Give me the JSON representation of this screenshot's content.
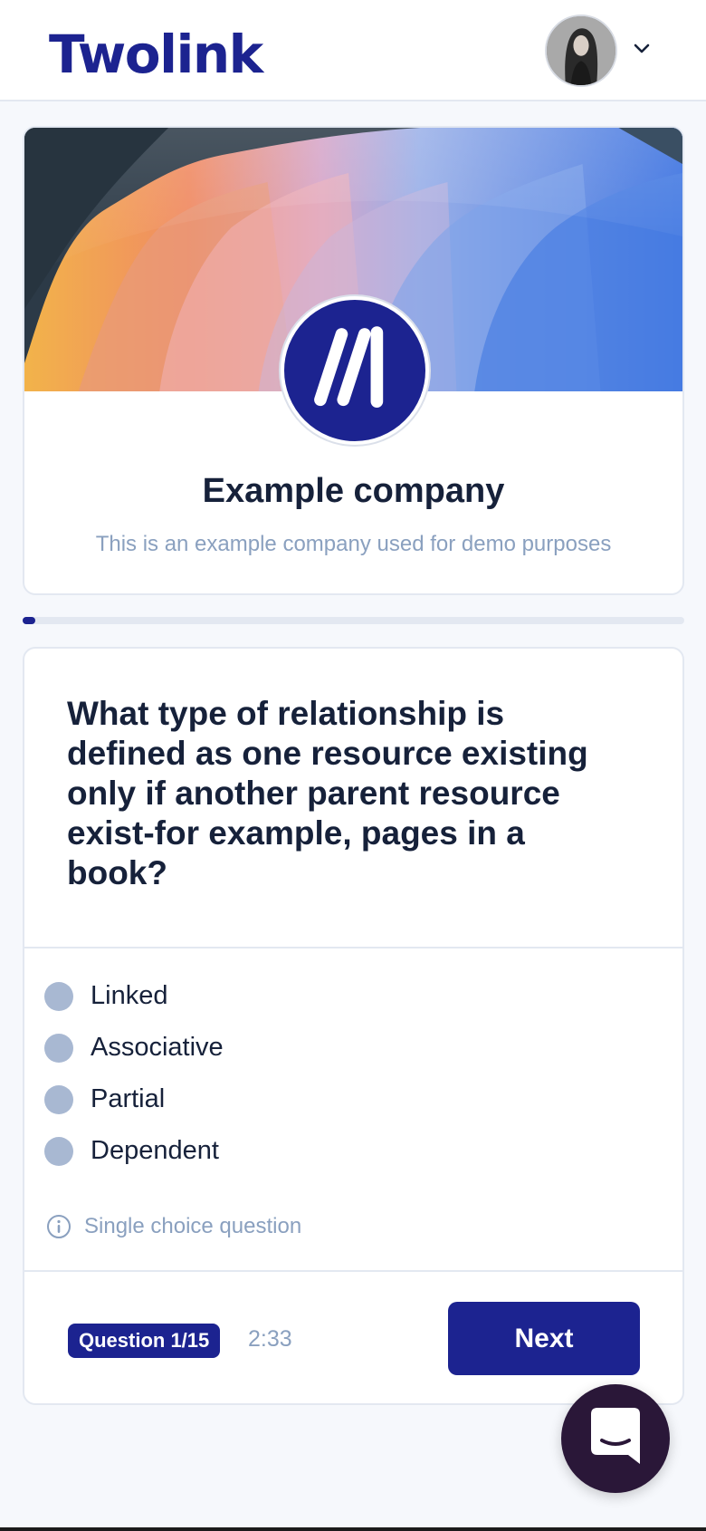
{
  "header": {
    "logo_text": "Twolink",
    "avatar_icon": "user-avatar",
    "menu_icon": "chevron-down-icon"
  },
  "company": {
    "name": "Example company",
    "description": "This is an example company used for demo purposes",
    "logo_icon": "company-logo-slashes"
  },
  "progress": {
    "fraction": 0.0667
  },
  "question": {
    "text": "What type of relationship is defined as one resource existing only if another parent resource exist-for example, pages in a book?",
    "options": [
      {
        "label": "Linked"
      },
      {
        "label": "Associative"
      },
      {
        "label": "Partial"
      },
      {
        "label": "Dependent"
      }
    ],
    "hint": "Single choice question",
    "hint_icon": "info-icon"
  },
  "footer": {
    "badge": "Question 1/15",
    "timer": "2:33",
    "next_label": "Next"
  },
  "chat": {
    "icon": "chat-icon"
  },
  "colors": {
    "brand": "#1c2390",
    "muted": "#8aa0bf",
    "radio": "#a8b8d2",
    "chat": "#2a1738"
  }
}
